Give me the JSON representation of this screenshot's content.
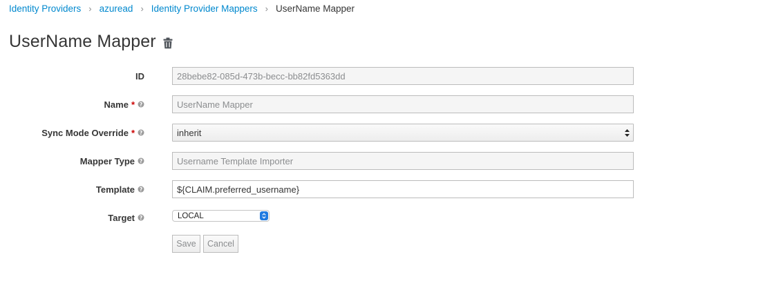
{
  "breadcrumb": {
    "items": [
      "Identity Providers",
      "azuread",
      "Identity Provider Mappers"
    ],
    "current": "UserName Mapper",
    "separator": "›"
  },
  "page": {
    "title": "UserName Mapper",
    "delete_icon": "trash-icon"
  },
  "form": {
    "id": {
      "label": "ID",
      "value": "28bebe82-085d-473b-becc-bb82fd5363dd"
    },
    "name": {
      "label": "Name",
      "required_mark": "*",
      "value": "UserName Mapper"
    },
    "sync_mode": {
      "label": "Sync Mode Override",
      "required_mark": "*",
      "value": "inherit"
    },
    "mapper_type": {
      "label": "Mapper Type",
      "value": "Username Template Importer"
    },
    "template": {
      "label": "Template",
      "value": "${CLAIM.preferred_username}"
    },
    "target": {
      "label": "Target",
      "value": "LOCAL"
    }
  },
  "actions": {
    "save_label": "Save",
    "cancel_label": "Cancel"
  },
  "colors": {
    "link": "#0088ce",
    "required": "#cc0000",
    "readonly_bg": "#f5f5f5",
    "select_accent": "#1f7ae0"
  },
  "icons": {
    "help": "question-circle-icon",
    "select_caret": "updown-caret-icon"
  }
}
